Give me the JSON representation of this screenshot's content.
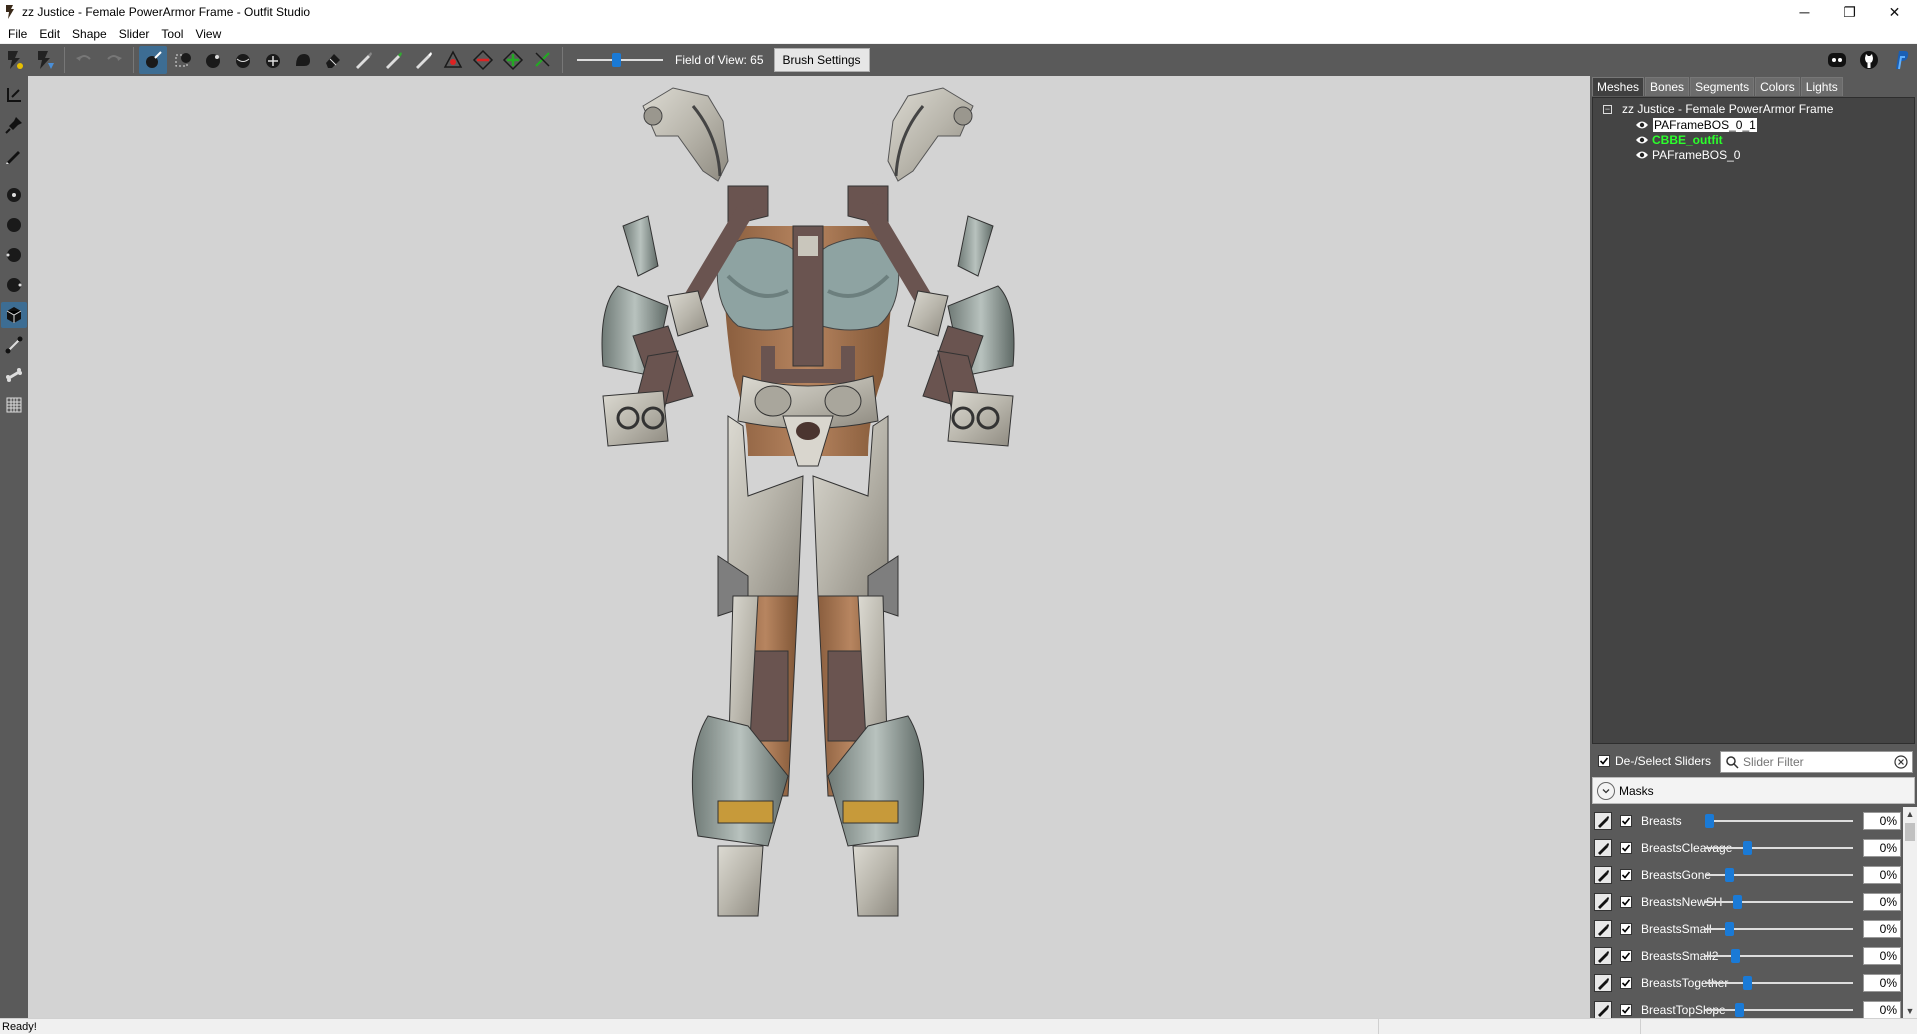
{
  "window": {
    "title": "zz Justice - Female PowerArmor Frame - Outfit Studio",
    "minimize": "─",
    "restore": "❐",
    "close": "✕"
  },
  "menu": [
    "File",
    "Edit",
    "Shape",
    "Slider",
    "Tool",
    "View"
  ],
  "toolbar": {
    "fov_label": "Field of View: 65",
    "fov_value": 65,
    "brush_settings": "Brush Settings"
  },
  "tabs": [
    "Meshes",
    "Bones",
    "Segments",
    "Colors",
    "Lights"
  ],
  "active_tab": "Meshes",
  "tree": {
    "root": "zz Justice - Female PowerArmor Frame",
    "toggle": "−",
    "items": [
      {
        "label": "PAFrameBOS_0_1",
        "state": "selected"
      },
      {
        "label": "CBBE_outfit",
        "state": "active"
      },
      {
        "label": "PAFrameBOS_0",
        "state": "normal"
      }
    ]
  },
  "slider_panel": {
    "deselect_label": "De-/Select Sliders",
    "filter_placeholder": "Slider Filter",
    "masks_label": "Masks",
    "sliders": [
      {
        "name": "Breasts",
        "value": "0%"
      },
      {
        "name": "BreastsCleavage",
        "value": "0%"
      },
      {
        "name": "BreastsGone",
        "value": "0%"
      },
      {
        "name": "BreastsNewSH",
        "value": "0%"
      },
      {
        "name": "BreastsSmall",
        "value": "0%"
      },
      {
        "name": "BreastsSmall2",
        "value": "0%"
      },
      {
        "name": "BreastsTogether",
        "value": "0%"
      },
      {
        "name": "BreastTopSlope",
        "value": "0%"
      }
    ]
  },
  "status": "Ready!",
  "colors": {
    "toolbar_bg": "#5a5a5a",
    "viewport_bg": "#d3d3d3",
    "accent": "#1a7ad6",
    "active_mesh": "#2bff2b"
  }
}
